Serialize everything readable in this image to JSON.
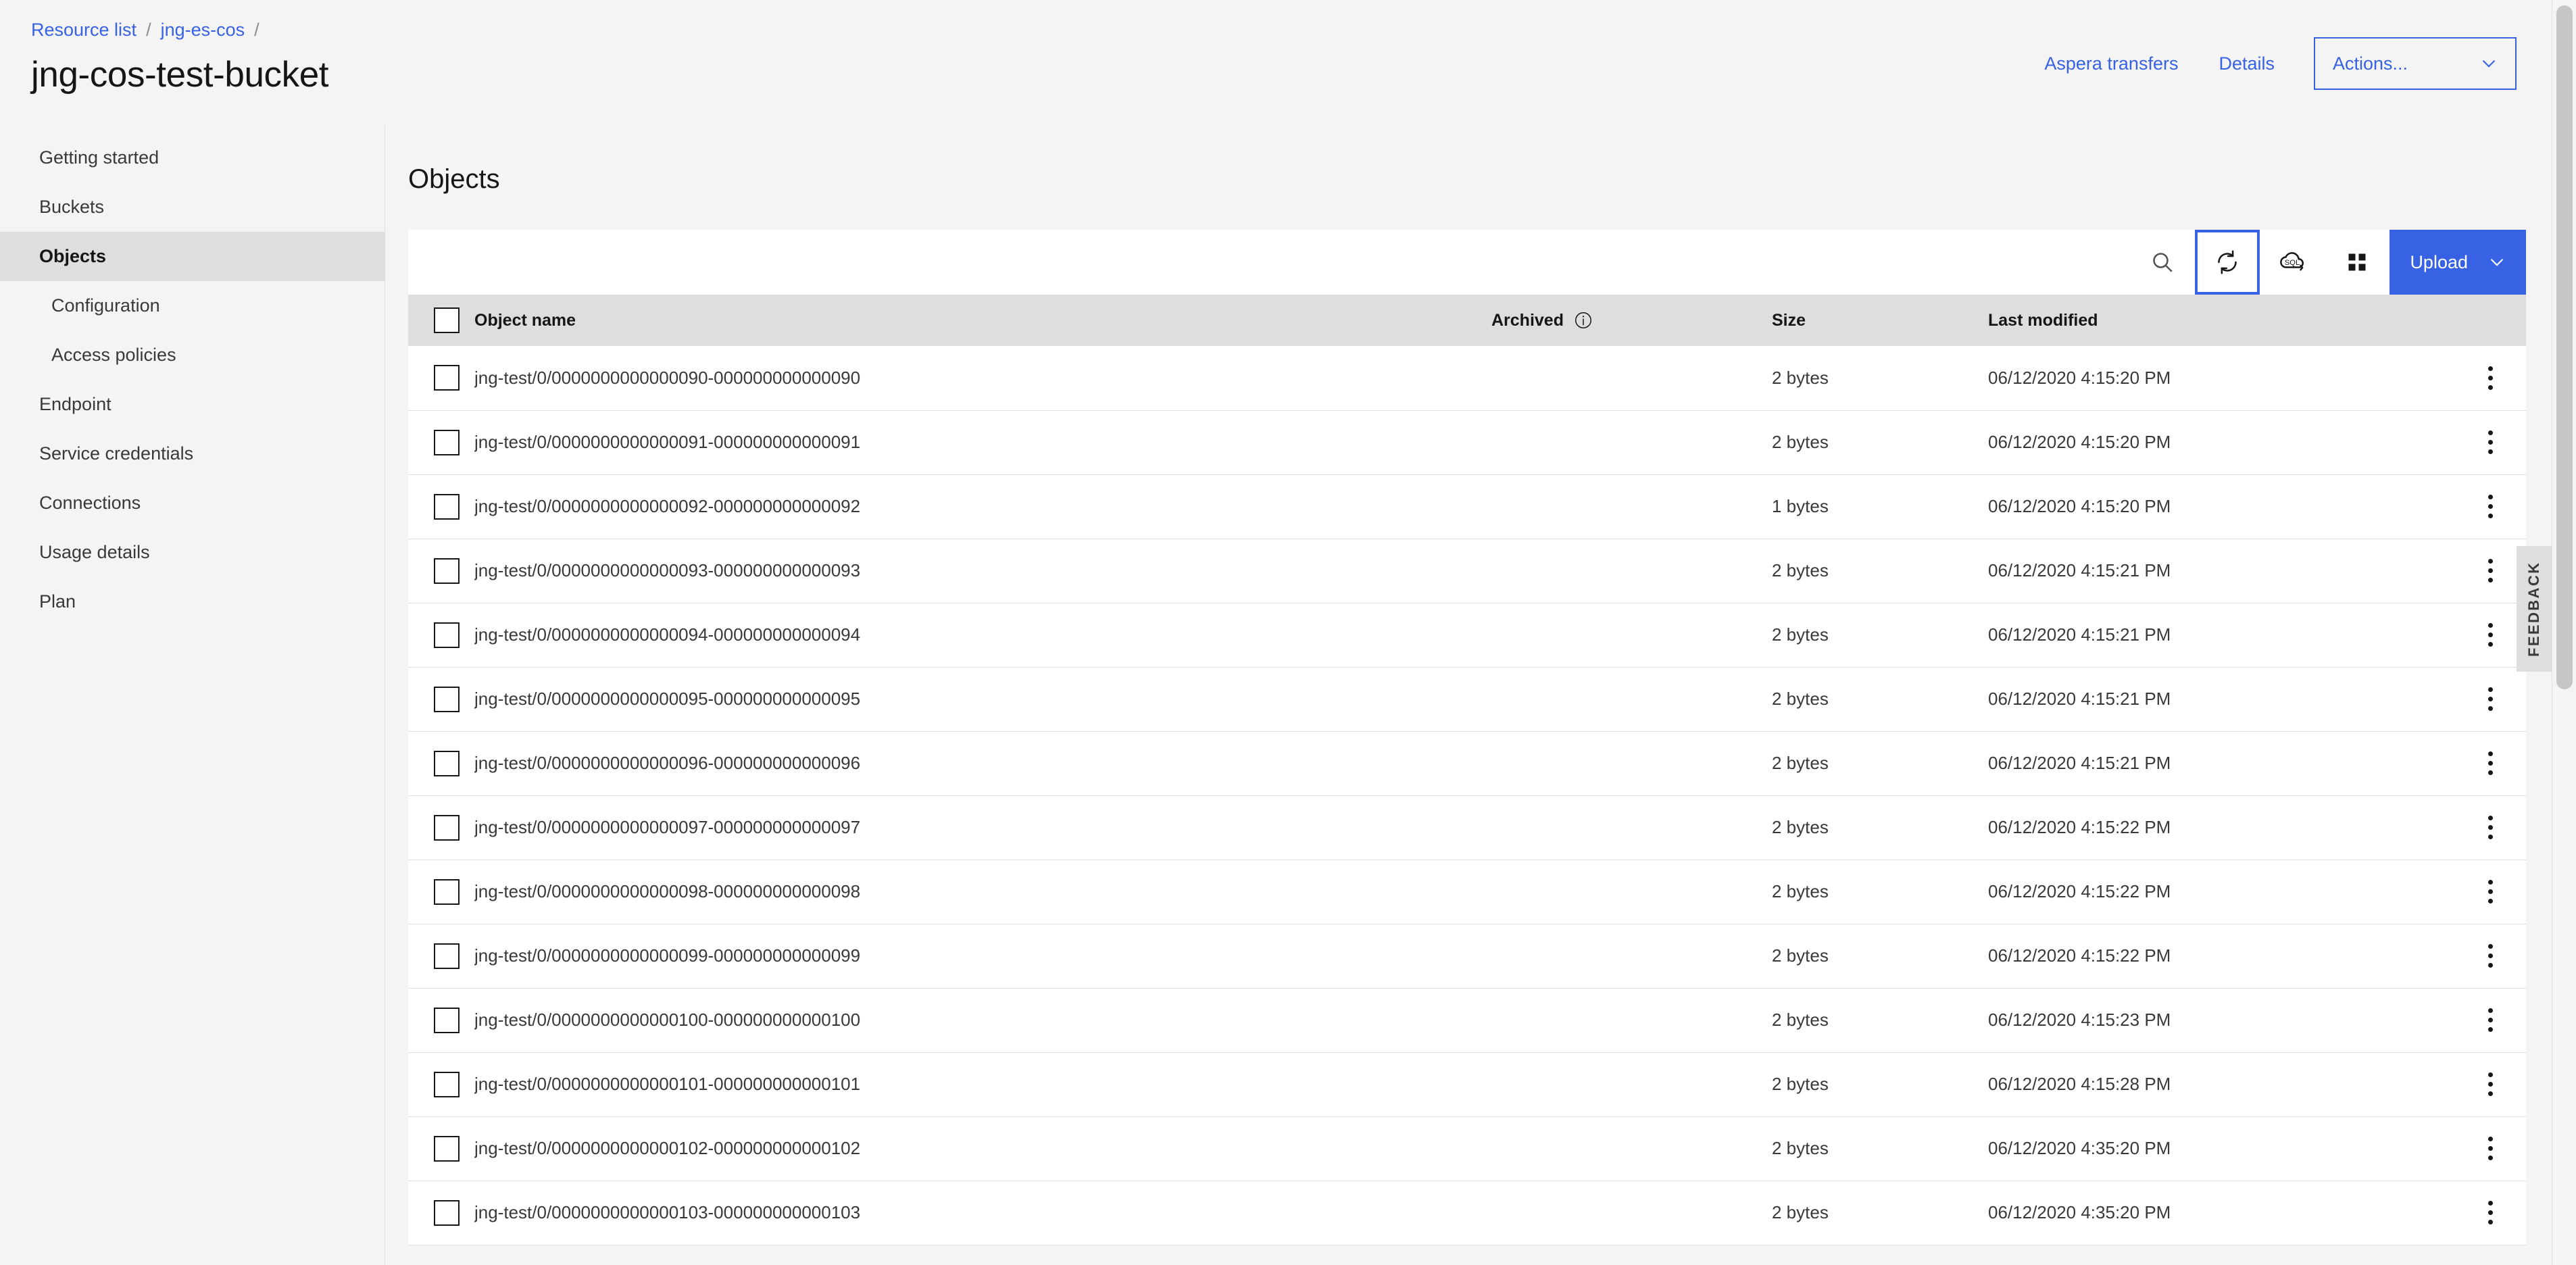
{
  "header": {
    "breadcrumb": [
      {
        "label": "Resource list"
      },
      {
        "label": "jng-es-cos"
      }
    ],
    "separator": "/",
    "bucket_title": "jng-cos-test-bucket",
    "aspera_transfers": "Aspera transfers",
    "details": "Details",
    "actions": "Actions...",
    "accent_color": "#3662e3"
  },
  "sidebar": {
    "items": [
      {
        "label": "Getting started",
        "active": false,
        "sub": false
      },
      {
        "label": "Buckets",
        "active": false,
        "sub": false
      },
      {
        "label": "Objects",
        "active": true,
        "sub": false
      },
      {
        "label": "Configuration",
        "active": false,
        "sub": true
      },
      {
        "label": "Access policies",
        "active": false,
        "sub": true
      },
      {
        "label": "Endpoint",
        "active": false,
        "sub": false
      },
      {
        "label": "Service credentials",
        "active": false,
        "sub": false
      },
      {
        "label": "Connections",
        "active": false,
        "sub": false
      },
      {
        "label": "Usage details",
        "active": false,
        "sub": false
      },
      {
        "label": "Plan",
        "active": false,
        "sub": false
      }
    ]
  },
  "main": {
    "section_title": "Objects",
    "toolbar": {
      "search_icon": "search-icon",
      "refresh_icon": "refresh-icon",
      "sql_query_icon": "sql-cloud-icon",
      "grid_view_icon": "grid-view-icon",
      "upload_label": "Upload",
      "upload_chevron_icon": "chevron-down-icon",
      "focused_button": "refresh-icon"
    },
    "table": {
      "columns": [
        "Object name",
        "Archived",
        "Size",
        "Last modified"
      ],
      "archived_info_icon": "info-icon",
      "select_all": "select-all-checkbox",
      "row_menu_icon": "overflow-menu-icon",
      "rows": [
        {
          "name": "jng-test/0/0000000000000090-000000000000090",
          "archived": "",
          "size": "2 bytes",
          "modified": "06/12/2020 4:15:20 PM"
        },
        {
          "name": "jng-test/0/0000000000000091-000000000000091",
          "archived": "",
          "size": "2 bytes",
          "modified": "06/12/2020 4:15:20 PM"
        },
        {
          "name": "jng-test/0/0000000000000092-000000000000092",
          "archived": "",
          "size": "1 bytes",
          "modified": "06/12/2020 4:15:20 PM"
        },
        {
          "name": "jng-test/0/0000000000000093-000000000000093",
          "archived": "",
          "size": "2 bytes",
          "modified": "06/12/2020 4:15:21 PM"
        },
        {
          "name": "jng-test/0/0000000000000094-000000000000094",
          "archived": "",
          "size": "2 bytes",
          "modified": "06/12/2020 4:15:21 PM"
        },
        {
          "name": "jng-test/0/0000000000000095-000000000000095",
          "archived": "",
          "size": "2 bytes",
          "modified": "06/12/2020 4:15:21 PM"
        },
        {
          "name": "jng-test/0/0000000000000096-000000000000096",
          "archived": "",
          "size": "2 bytes",
          "modified": "06/12/2020 4:15:21 PM"
        },
        {
          "name": "jng-test/0/0000000000000097-000000000000097",
          "archived": "",
          "size": "2 bytes",
          "modified": "06/12/2020 4:15:22 PM"
        },
        {
          "name": "jng-test/0/0000000000000098-000000000000098",
          "archived": "",
          "size": "2 bytes",
          "modified": "06/12/2020 4:15:22 PM"
        },
        {
          "name": "jng-test/0/0000000000000099-000000000000099",
          "archived": "",
          "size": "2 bytes",
          "modified": "06/12/2020 4:15:22 PM"
        },
        {
          "name": "jng-test/0/0000000000000100-000000000000100",
          "archived": "",
          "size": "2 bytes",
          "modified": "06/12/2020 4:15:23 PM"
        },
        {
          "name": "jng-test/0/0000000000000101-000000000000101",
          "archived": "",
          "size": "2 bytes",
          "modified": "06/12/2020 4:15:28 PM"
        },
        {
          "name": "jng-test/0/0000000000000102-000000000000102",
          "archived": "",
          "size": "2 bytes",
          "modified": "06/12/2020 4:35:20 PM"
        },
        {
          "name": "jng-test/0/0000000000000103-000000000000103",
          "archived": "",
          "size": "2 bytes",
          "modified": "06/12/2020 4:35:20 PM"
        }
      ]
    }
  },
  "feedback": {
    "label": "FEEDBACK"
  }
}
